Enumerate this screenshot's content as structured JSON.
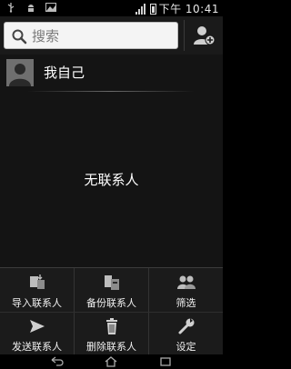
{
  "status_bar": {
    "time": "下午 10:41",
    "icons": [
      "usb-icon",
      "android-debug-icon",
      "notification-image-icon",
      "signal-icon",
      "battery-icon"
    ]
  },
  "search": {
    "placeholder": "搜索",
    "value": "",
    "icon": "search-icon",
    "add_contact_icon": "add-contact-icon"
  },
  "contacts": {
    "me_label": "我自己",
    "avatar_icon": "person-silhouette-icon",
    "empty_message": "无联系人"
  },
  "menu": {
    "items": [
      {
        "label": "导入联系人",
        "icon": "import-contacts-icon"
      },
      {
        "label": "备份联系人",
        "icon": "backup-contacts-icon"
      },
      {
        "label": "筛选",
        "icon": "filter-groups-icon"
      },
      {
        "label": "发送联系人",
        "icon": "send-icon"
      },
      {
        "label": "删除联系人",
        "icon": "trash-icon"
      },
      {
        "label": "设定",
        "icon": "wrench-icon"
      }
    ]
  },
  "navbar": {
    "buttons": [
      "back-icon",
      "home-icon",
      "recent-apps-icon"
    ]
  },
  "colors": {
    "background": "#141414",
    "search_box": "#f4f4f4",
    "menu_background": "#1b1b1b",
    "text": "#ffffff"
  }
}
